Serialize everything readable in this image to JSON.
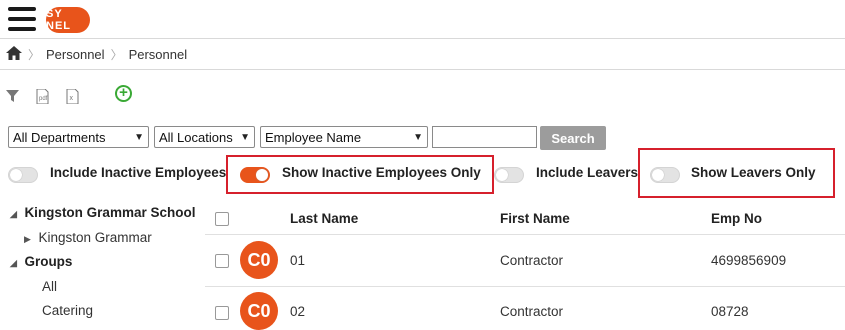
{
  "header": {
    "logo_text": "SY NEL"
  },
  "breadcrumb": [
    "Personnel",
    "Personnel"
  ],
  "toolbar": {
    "add_symbol": "+"
  },
  "filters": {
    "department": "All Departments",
    "location": "All Locations",
    "field": "Employee Name",
    "search_value": "",
    "search_button": "Search"
  },
  "toggles": [
    {
      "label": "Include Inactive Employees",
      "on": false
    },
    {
      "label": "Show Inactive Employees Only",
      "on": true
    },
    {
      "label": "Include Leavers",
      "on": false
    },
    {
      "label": "Show Leavers Only",
      "on": false
    }
  ],
  "tree": {
    "root": "Kingston Grammar School",
    "child": "Kingston Grammar",
    "groups": "Groups",
    "group_items": [
      "All",
      "Catering"
    ]
  },
  "table": {
    "columns": [
      "Last Name",
      "First Name",
      "Emp No"
    ],
    "rows": [
      {
        "avatar": "C0",
        "last_name": "01",
        "first_name": "Contractor",
        "emp_no": "4699856909"
      },
      {
        "avatar": "C0",
        "last_name": "02",
        "first_name": "Contractor",
        "emp_no": "08728"
      }
    ]
  },
  "colors": {
    "accent": "#e8541b",
    "highlight": "#d6202c",
    "add": "#3aa935"
  }
}
